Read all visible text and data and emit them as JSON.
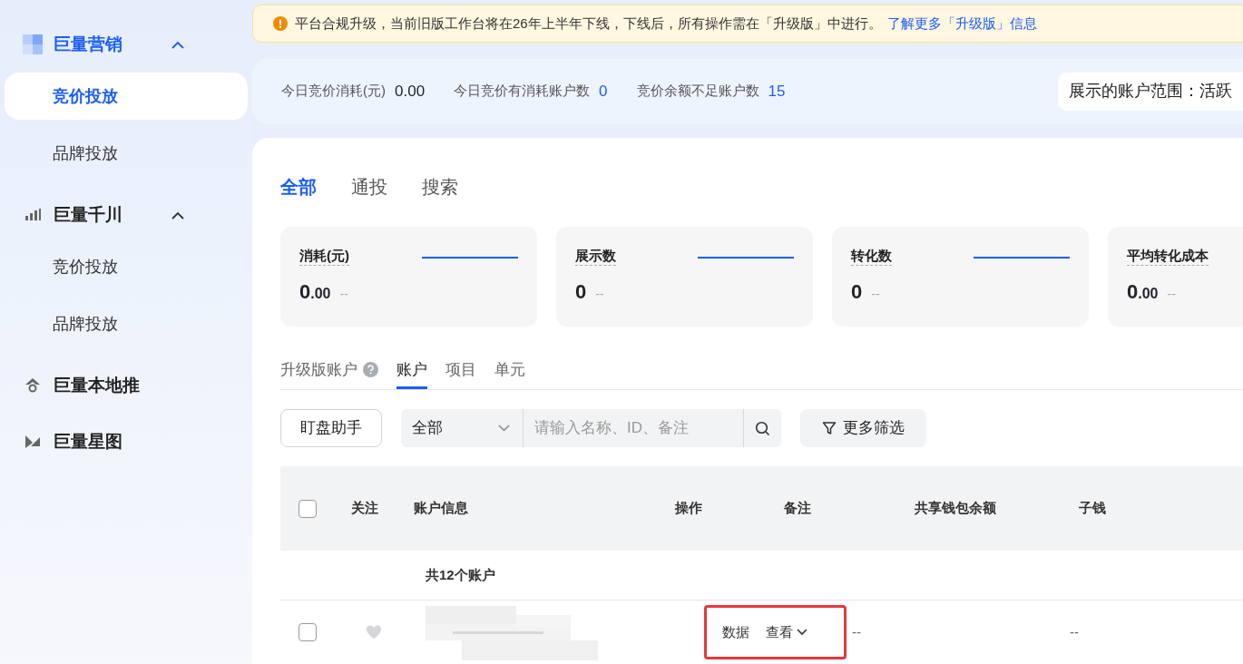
{
  "sidebar": {
    "groups": [
      {
        "title": "巨量营销",
        "selected": true,
        "expanded": true,
        "items": [
          {
            "label": "竞价投放",
            "selected": true
          },
          {
            "label": "品牌投放",
            "selected": false
          }
        ]
      },
      {
        "title": "巨量千川",
        "selected": false,
        "expanded": true,
        "items": [
          {
            "label": "竞价投放",
            "selected": false
          },
          {
            "label": "品牌投放",
            "selected": false
          }
        ]
      },
      {
        "title": "巨量本地推",
        "selected": false
      },
      {
        "title": "巨量星图",
        "selected": false
      }
    ]
  },
  "notice": {
    "text": "平台合规升级，当前旧版工作台将在26年上半年下线，下线后，所有操作需在「升级版」中进行。",
    "link": "了解更多「升级版」信息"
  },
  "summary": {
    "stats": [
      {
        "label": "今日竞价消耗(元)",
        "value": "0.00",
        "kind": "plain"
      },
      {
        "label": "今日竞价有消耗账户数",
        "value": "0",
        "kind": "link"
      },
      {
        "label": "竞价余额不足账户数",
        "value": "15",
        "kind": "link"
      }
    ],
    "scope": "展示的账户范围：活跃"
  },
  "channel_tabs": [
    {
      "label": "全部",
      "selected": true
    },
    {
      "label": "通投",
      "selected": false
    },
    {
      "label": "搜索",
      "selected": false
    }
  ],
  "metrics": [
    {
      "label": "消耗(元)",
      "value": "0",
      "decimals": ".00",
      "change": "--"
    },
    {
      "label": "展示数",
      "value": "0",
      "change": "--"
    },
    {
      "label": "转化数",
      "value": "0",
      "change": "--"
    },
    {
      "label": "平均转化成本",
      "value": "0",
      "decimals": ".00",
      "change": "--"
    }
  ],
  "level_tabs": [
    {
      "label": "升级版账户",
      "selected": false,
      "help": true
    },
    {
      "label": "账户",
      "selected": true
    },
    {
      "label": "项目",
      "selected": false
    },
    {
      "label": "单元",
      "selected": false
    }
  ],
  "toolbar": {
    "assistant_button": "盯盘助手",
    "scope_select": "全部",
    "search_placeholder": "请输入名称、ID、备注",
    "filter_button": "更多筛选"
  },
  "table": {
    "header_checked": false,
    "columns": [
      "关注",
      "账户信息",
      "操作",
      "备注",
      "共享钱包余额",
      "子钱"
    ],
    "total": "共12个账户",
    "rows": [
      {
        "checked": false,
        "followed": false,
        "actions": [
          "数据",
          "查看"
        ],
        "note": "--",
        "shared_balance": "--",
        "highlighted": true
      }
    ]
  }
}
